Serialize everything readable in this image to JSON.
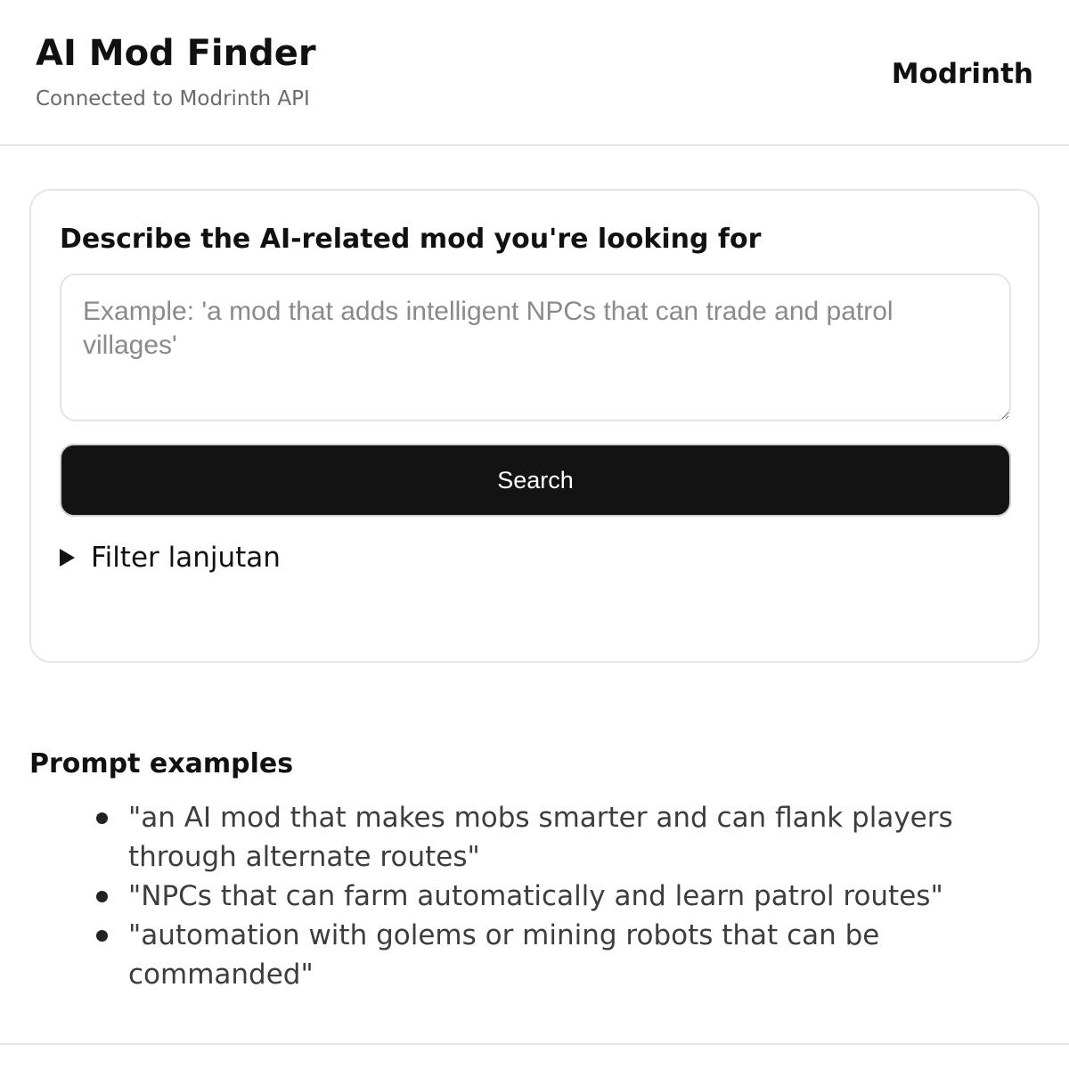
{
  "header": {
    "title": "AI Mod Finder",
    "subtitle": "Connected to Modrinth API",
    "brand_link": "Modrinth"
  },
  "search_card": {
    "label": "Describe the AI-related mod you're looking for",
    "input_value": "",
    "input_placeholder": "Example: 'a mod that adds intelligent NPCs that can trade and patrol villages'",
    "search_button_label": "Search",
    "filter_toggle_label": "Filter lanjutan",
    "filter_expanded": false
  },
  "examples": {
    "title": "Prompt examples",
    "items": [
      "\"an AI mod that makes mobs smarter and can flank players through alternate routes\"",
      "\"NPCs that can farm automatically and learn patrol routes\"",
      "\"automation with golems or mining robots that can be commanded\""
    ]
  },
  "icons": {
    "filter_toggle": "disclosure-triangle-right-icon",
    "list_bullet": "bullet-dot-icon"
  },
  "colors": {
    "button_background": "#131313",
    "button_text": "#ffffff",
    "subtitle_text": "#6a6a6a",
    "border": "#e4e4e4"
  }
}
